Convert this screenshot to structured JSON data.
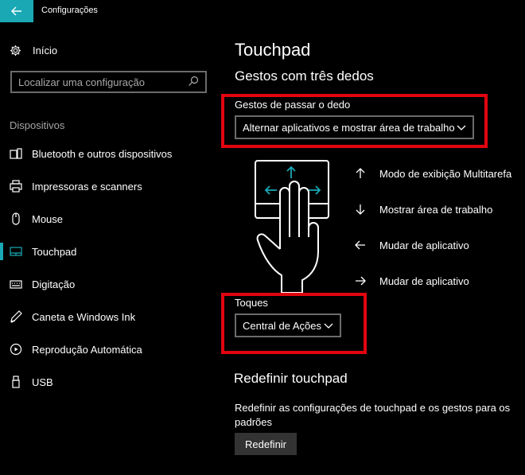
{
  "window": {
    "title": "Configurações"
  },
  "sidebar": {
    "home_label": "Início",
    "search_placeholder": "Localizar uma configuração",
    "section_title": "Dispositivos",
    "items": [
      {
        "label": "Bluetooth e outros dispositivos",
        "icon": "bluetooth-devices-icon"
      },
      {
        "label": "Impressoras e scanners",
        "icon": "printer-icon"
      },
      {
        "label": "Mouse",
        "icon": "mouse-icon"
      },
      {
        "label": "Touchpad",
        "icon": "touchpad-icon",
        "active": true
      },
      {
        "label": "Digitação",
        "icon": "keyboard-icon"
      },
      {
        "label": "Caneta e Windows Ink",
        "icon": "pen-icon"
      },
      {
        "label": "Reprodução Automática",
        "icon": "autoplay-icon"
      },
      {
        "label": "USB",
        "icon": "usb-icon"
      }
    ]
  },
  "main": {
    "title": "Touchpad",
    "subtitle": "Gestos com três dedos",
    "swipe": {
      "label": "Gestos de passar o dedo",
      "value": "Alternar aplicativos e mostrar área de trabalho"
    },
    "gestures": [
      {
        "direction": "up",
        "label": "Modo de exibição Multitarefa"
      },
      {
        "direction": "down",
        "label": "Mostrar área de trabalho"
      },
      {
        "direction": "left",
        "label": "Mudar de aplicativo"
      },
      {
        "direction": "right",
        "label": "Mudar de aplicativo"
      }
    ],
    "taps": {
      "label": "Toques",
      "value": "Central de Ações"
    },
    "reset": {
      "title": "Redefinir touchpad",
      "description": "Redefinir as configurações de touchpad e os gestos para os padrões",
      "button_label": "Redefinir"
    }
  },
  "colors": {
    "accent": "#1aa8b5",
    "highlight": "#e10510",
    "background": "#000000"
  }
}
